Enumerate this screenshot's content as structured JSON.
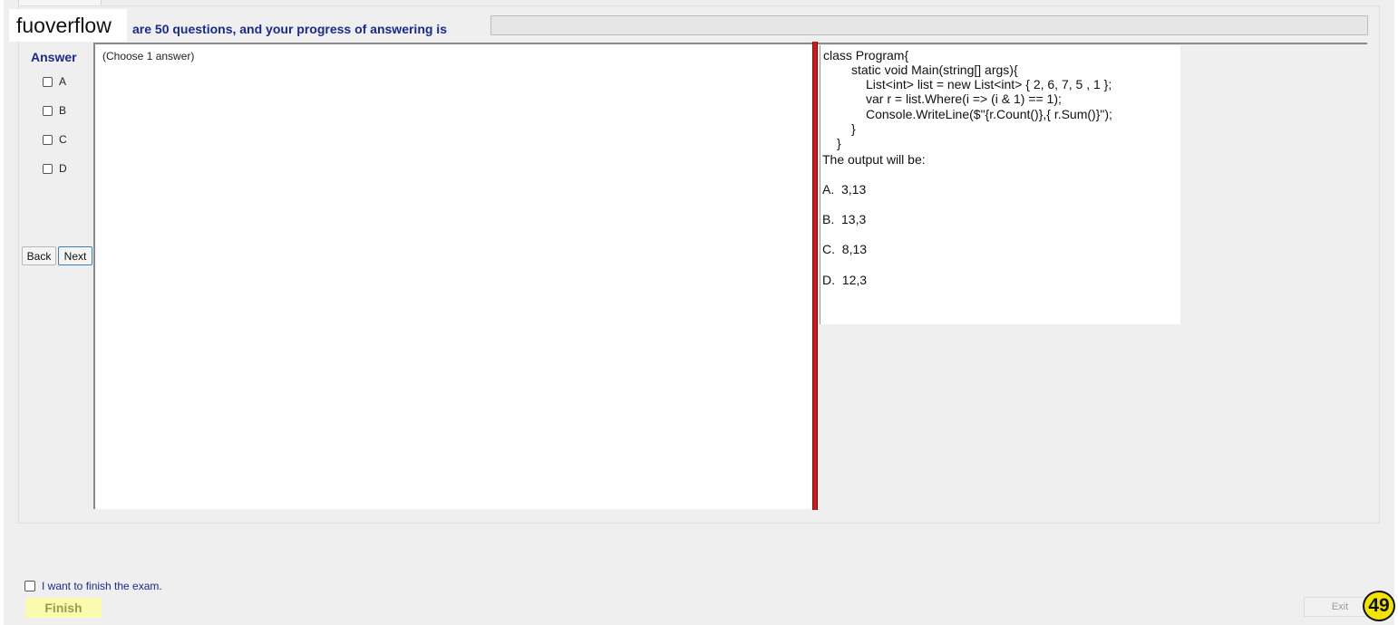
{
  "brand": "fuoverflow",
  "progress": {
    "text": "are 50 questions, and your progress of answering is",
    "fraction": 0
  },
  "answer": {
    "title": "Answer",
    "options": [
      "A",
      "B",
      "C",
      "D"
    ]
  },
  "nav": {
    "back": "Back",
    "next": "Next"
  },
  "instruction": "(Choose 1 answer)",
  "question": {
    "code": [
      "class Program{",
      "static void Main(string[] args){",
      "List<int> list = new List<int> { 2, 6, 7, 5 , 1 };",
      "var r = list.Where(i => (i & 1) == 1);",
      "Console.WriteLine($\"{r.Count()},{ r.Sum()}\");",
      "}",
      "}"
    ],
    "prompt": "The output will be:",
    "choices": [
      "A.  3,13",
      "B.  13,3",
      "C.  8,13",
      "D.  12,3"
    ]
  },
  "footer": {
    "finish_check_label": "I want to finish the exam.",
    "finish_button": "Finish",
    "exit_button": "Exit",
    "question_number": "49"
  },
  "colors": {
    "accent_text": "#1a2a8c",
    "splitter": "#d21919",
    "finish_bg": "#fbfbb0",
    "counter_bg": "#f2e400"
  }
}
